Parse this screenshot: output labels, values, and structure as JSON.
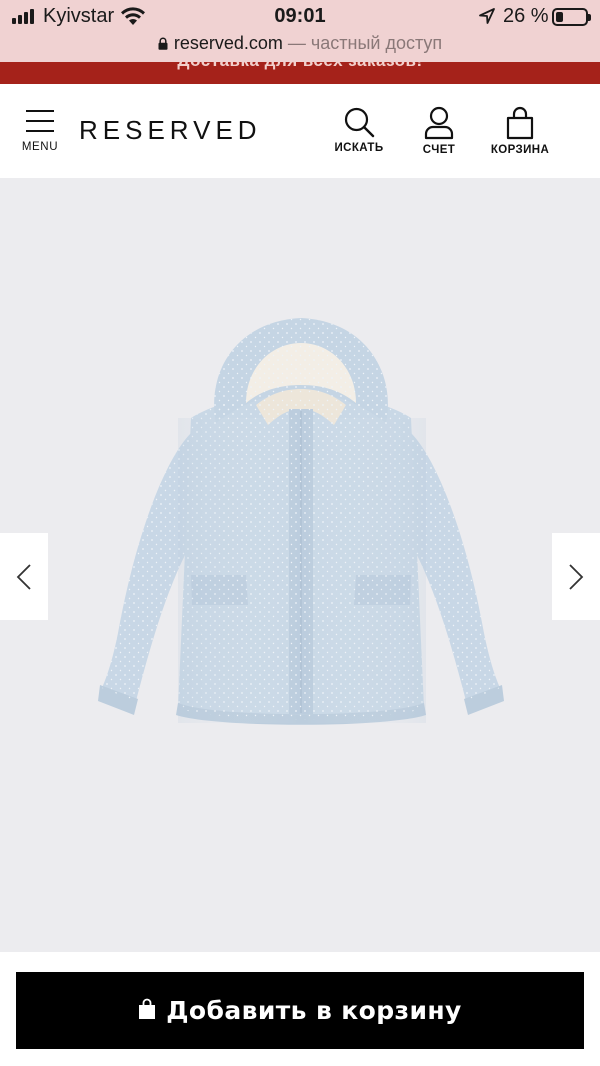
{
  "status_bar": {
    "carrier": "Kyivstar",
    "time": "09:01",
    "battery_percent": "26 %",
    "battery_level": 0.26,
    "icons": [
      "signal-icon",
      "wifi-icon",
      "location-arrow-icon",
      "battery-icon"
    ]
  },
  "browser": {
    "domain": "reserved.com",
    "private_label": " — частный доступ",
    "lock_icon": "lock-icon"
  },
  "promo": {
    "text": "Доставка для всех заказов!"
  },
  "header": {
    "menu_label": "MENU",
    "logo": "RESERVED",
    "search_label": "ИСКАТЬ",
    "account_label": "СЧЕТ",
    "cart_label": "КОРЗИНА"
  },
  "gallery": {
    "image_alt": "jacket-image",
    "prev_icon": "chevron-left-icon",
    "next_icon": "chevron-right-icon"
  },
  "cart_button": {
    "label": "Добавить в корзину",
    "icon": "shopping-bag-icon"
  },
  "colors": {
    "browser_bar": "#f0d2d2",
    "promo_strip": "#a5221a",
    "gallery_bg": "#ececef",
    "jacket": "#c9d8e6",
    "button_bg": "#000000",
    "button_text": "#ffffff"
  }
}
